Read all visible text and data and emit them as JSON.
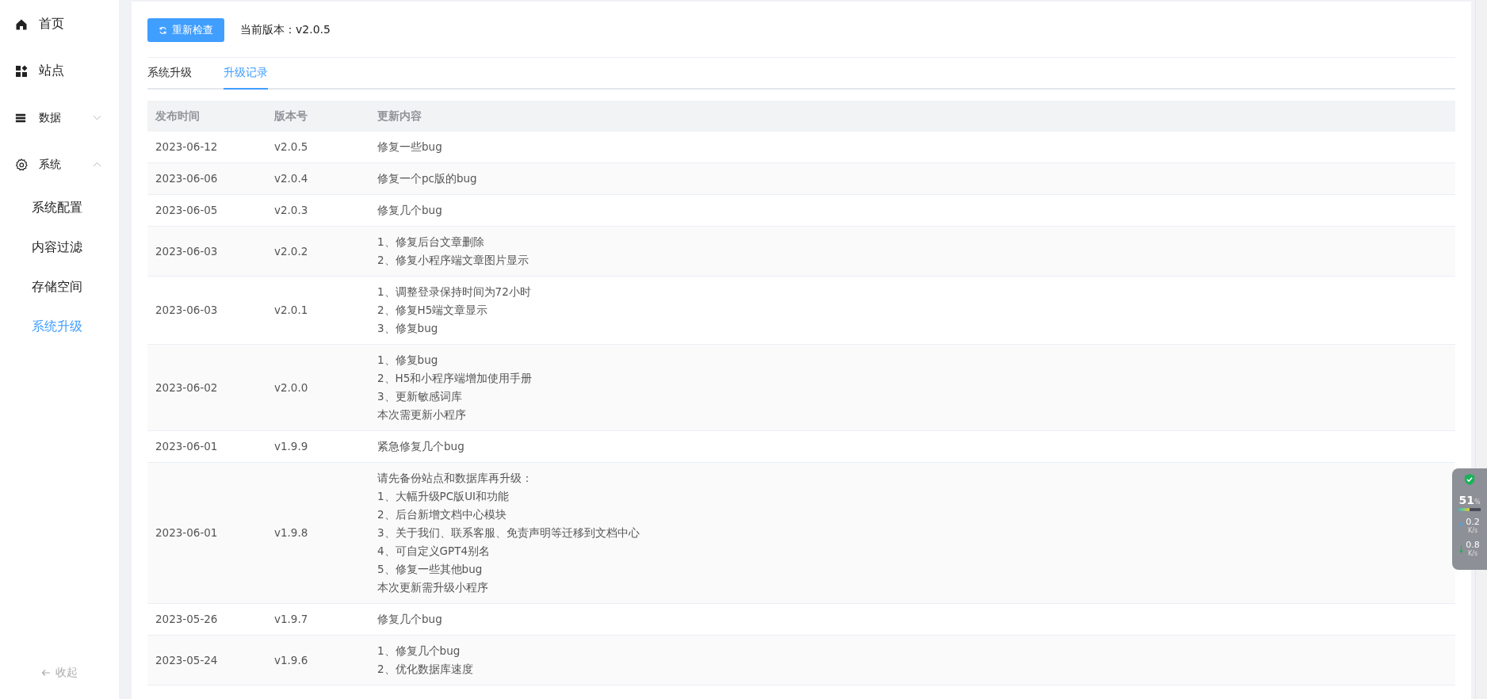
{
  "sidebar": {
    "items": [
      {
        "label": "首页",
        "selected": false
      },
      {
        "label": "站点",
        "selected": false
      },
      {
        "label": "数据",
        "expanded": false
      },
      {
        "label": "系统",
        "expanded": true,
        "children": [
          {
            "label": "系统配置",
            "selected": false
          },
          {
            "label": "内容过滤",
            "selected": false
          },
          {
            "label": "存储空间",
            "selected": false
          },
          {
            "label": "系统升级",
            "selected": true
          }
        ]
      }
    ],
    "collapse": "收起"
  },
  "toolbar": {
    "recheck_button": "重新检查",
    "current_version": "当前版本：v2.0.5"
  },
  "tabs": [
    {
      "label": "系统升级",
      "selected": false
    },
    {
      "label": "升级记录",
      "selected": true
    }
  ],
  "table": {
    "columns": [
      "发布时间",
      "版本号",
      "更新内容"
    ],
    "rows": [
      {
        "date": "2023-06-12",
        "version": "v2.0.5",
        "content": [
          "修复一些bug"
        ]
      },
      {
        "date": "2023-06-06",
        "version": "v2.0.4",
        "content": [
          "修复一个pc版的bug"
        ]
      },
      {
        "date": "2023-06-05",
        "version": "v2.0.3",
        "content": [
          "修复几个bug"
        ]
      },
      {
        "date": "2023-06-03",
        "version": "v2.0.2",
        "content": [
          "1、修复后台文章删除",
          "2、修复小程序端文章图片显示"
        ]
      },
      {
        "date": "2023-06-03",
        "version": "v2.0.1",
        "content": [
          "1、调整登录保持时间为72小时",
          "2、修复H5端文章显示",
          "3、修复bug"
        ]
      },
      {
        "date": "2023-06-02",
        "version": "v2.0.0",
        "content": [
          "1、修复bug",
          "2、H5和小程序端增加使用手册",
          "3、更新敏感词库",
          "本次需更新小程序"
        ]
      },
      {
        "date": "2023-06-01",
        "version": "v1.9.9",
        "content": [
          "紧急修复几个bug"
        ]
      },
      {
        "date": "2023-06-01",
        "version": "v1.9.8",
        "content": [
          "请先备份站点和数据库再升级：",
          "1、大幅升级PC版UI和功能",
          "2、后台新增文档中心模块",
          "3、关于我们、联系客服、免责声明等迁移到文档中心",
          "4、可自定义GPT4别名",
          "5、修复一些其他bug",
          "本次更新需升级小程序"
        ]
      },
      {
        "date": "2023-05-26",
        "version": "v1.9.7",
        "content": [
          "修复几个bug"
        ]
      },
      {
        "date": "2023-05-24",
        "version": "v1.9.6",
        "content": [
          "1、修复几个bug",
          "2、优化数据库速度"
        ]
      }
    ]
  },
  "net_widget": {
    "percent": "51",
    "percent_unit": "%",
    "up": "0.2",
    "up_unit": "K/s",
    "down": "0.8",
    "down_unit": "K/s"
  }
}
